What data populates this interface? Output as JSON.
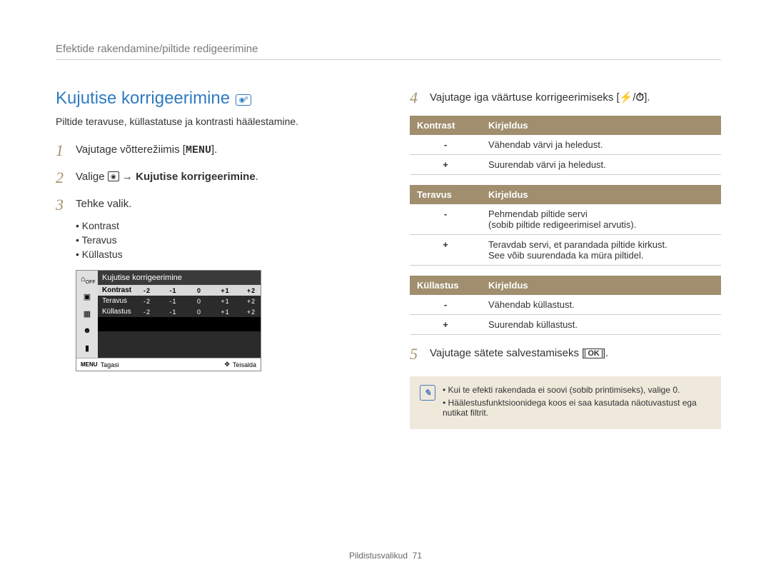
{
  "breadcrumb": "Efektide rakendamine/piltide redigeerimine",
  "section_title": "Kujutise korrigeerimine",
  "intro": "Piltide teravuse, küllastatuse ja kontrasti häälestamine.",
  "steps_left": {
    "s1_pre": "Vajutage võtterežiimis [",
    "s1_btn": "MENU",
    "s1_post": "].",
    "s2_pre": "Valige ",
    "s2_arrow": " → ",
    "s2_bold": "Kujutise korrigeerimine",
    "s2_post": ".",
    "s3": "Tehke valik."
  },
  "sub_items": [
    "Kontrast",
    "Teravus",
    "Küllastus"
  ],
  "camera_ui": {
    "title": "Kujutise korrigeerimine",
    "rows": [
      {
        "label": "Kontrast",
        "vals": [
          "-2",
          "-1",
          "0",
          "+1",
          "+2"
        ],
        "selected": true
      },
      {
        "label": "Teravus",
        "vals": [
          "-2",
          "-1",
          "0",
          "+1",
          "+2"
        ],
        "selected": false
      },
      {
        "label": "Küllastus",
        "vals": [
          "-2",
          "-1",
          "0",
          "+1",
          "+2"
        ],
        "selected": false
      }
    ],
    "footer_left_label": "Tagasi",
    "footer_right_label": "Teisalda",
    "footer_left_icon": "MENU"
  },
  "steps_right": {
    "s4_pre": "Vajutage iga väärtuse korrigeerimiseks [",
    "s4_icon1": "⚡",
    "s4_sep": "/",
    "s4_icon2": "⏱",
    "s4_post": "].",
    "s5_pre": "Vajutage sätete salvestamiseks [",
    "s5_btn": "OK",
    "s5_post": "]."
  },
  "tables": {
    "kontrast": {
      "h1": "Kontrast",
      "h2": "Kirjeldus",
      "rows": [
        {
          "k": "-",
          "v": "Vähendab värvi ja heledust."
        },
        {
          "k": "+",
          "v": "Suurendab värvi ja heledust."
        }
      ]
    },
    "teravus": {
      "h1": "Teravus",
      "h2": "Kirjeldus",
      "rows": [
        {
          "k": "-",
          "v": "Pehmendab piltide servi\n(sobib piltide redigeerimisel arvutis)."
        },
        {
          "k": "+",
          "v": "Teravdab servi, et parandada piltide kirkust.\nSee võib suurendada ka müra piltidel."
        }
      ]
    },
    "kyllastus": {
      "h1": "Küllastus",
      "h2": "Kirjeldus",
      "rows": [
        {
          "k": "-",
          "v": "Vähendab küllastust."
        },
        {
          "k": "+",
          "v": "Suurendab küllastust."
        }
      ]
    }
  },
  "notes": [
    "Kui te efekti rakendada ei soovi (sobib printimiseks), valige 0.",
    "Häälestusfunktsioonidega koos ei saa kasutada näotuvastust ega nutikat filtrit."
  ],
  "footer": {
    "label": "Pildistusvalikud",
    "page": "71"
  },
  "nums": {
    "n1": "1",
    "n2": "2",
    "n3": "3",
    "n4": "4",
    "n5": "5"
  }
}
